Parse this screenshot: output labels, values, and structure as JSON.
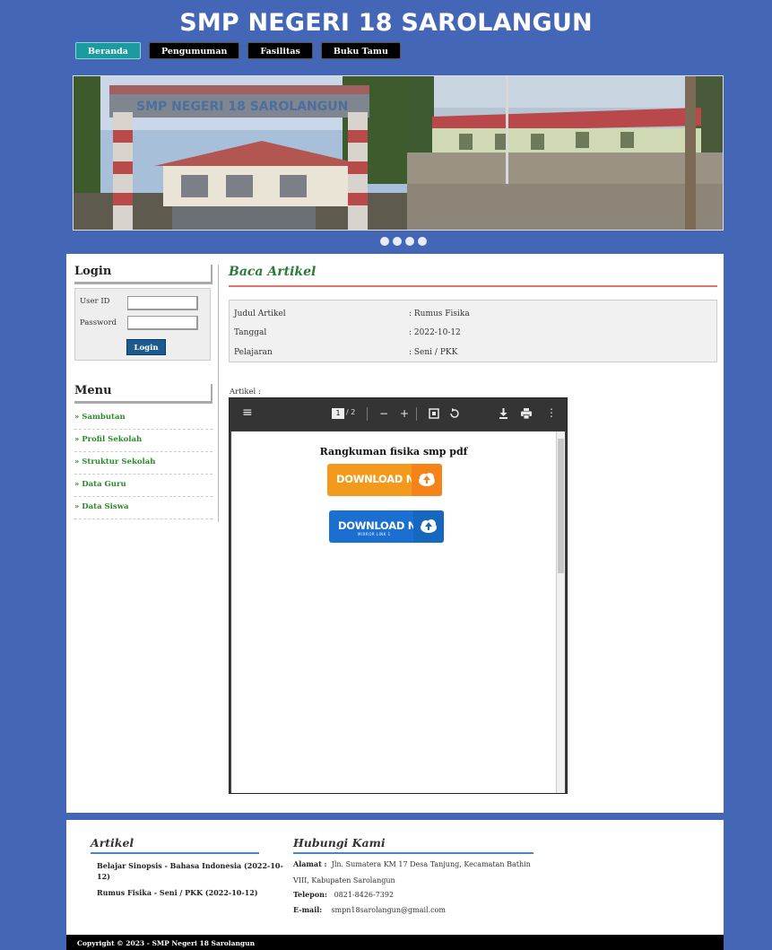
{
  "site": {
    "title": "SMP NEGERI 18 SAROLANGUN"
  },
  "nav": {
    "items": [
      "Beranda",
      "Pengumuman",
      "Fasilitas",
      "Buku Tamu"
    ],
    "active": "Beranda"
  },
  "banner": {
    "school_sign": "SMP NEGERI 18 SAROLANGUN",
    "slides": 4
  },
  "login": {
    "title": "Login",
    "user_label": "User ID",
    "password_label": "Password",
    "button_label": "Login"
  },
  "menu": {
    "title": "Menu",
    "items": [
      "» Sambutan",
      "» Profil Sekolah",
      "» Struktur Sekolah",
      "» Data Guru",
      "» Data Siswa"
    ]
  },
  "article": {
    "section_title": "Baca Artikel",
    "rows": [
      {
        "label": "Judul Artikel",
        "value": ": Rumus Fisika"
      },
      {
        "label": "Tanggal",
        "value": ": 2022-10-12"
      },
      {
        "label": "Pelajaran",
        "value": ": Seni / PKK"
      }
    ],
    "artikel_label": "Artikel :"
  },
  "pdf": {
    "page_current": "1",
    "page_total": "/ 2",
    "heading": "Rangkuman fisika smp pdf",
    "download1": "DOWNLOAD NOW",
    "download2": "DOWNLOAD NOW",
    "download2_sub": "MIRROR LINK 1"
  },
  "footer": {
    "artikel_title": "Artikel",
    "artikel_items": [
      "Belajar Sinopsis - Bahasa Indonesia (2022-10-",
      "12)",
      "Rumus Fisika - Seni / PKK (2022-10-12)"
    ],
    "contact_title": "Hubungi Kami",
    "alamat_label": "Alamat :",
    "alamat_value1": "Jln. Sumatera KM 17 Desa Tanjung, Kecamatan Bathin",
    "alamat_value2": "VIII, Kabupaten Sarolangun",
    "telepon_label": "Telepon:",
    "telepon_value": "0821-8426-7392",
    "email_label": "E-mail:",
    "email_value": "smpn18sarolangun@gmail.com"
  },
  "copyright": "Copyright © 2023 - SMP Negeri 18 Sarolangun",
  "colors": {
    "background": "#4466b6",
    "active_nav": "#1a9ba0",
    "menu_link": "#2a8a2a",
    "accent_line": "#e3716c",
    "download_orange": "#f39a1d",
    "download_blue": "#1a6fd0"
  },
  "icons": [
    "hamburger-menu-icon",
    "zoom-out-icon",
    "zoom-in-icon",
    "fit-page-icon",
    "rotate-icon",
    "download-icon",
    "print-icon",
    "more-options-icon",
    "cloud-upload-icon"
  ]
}
